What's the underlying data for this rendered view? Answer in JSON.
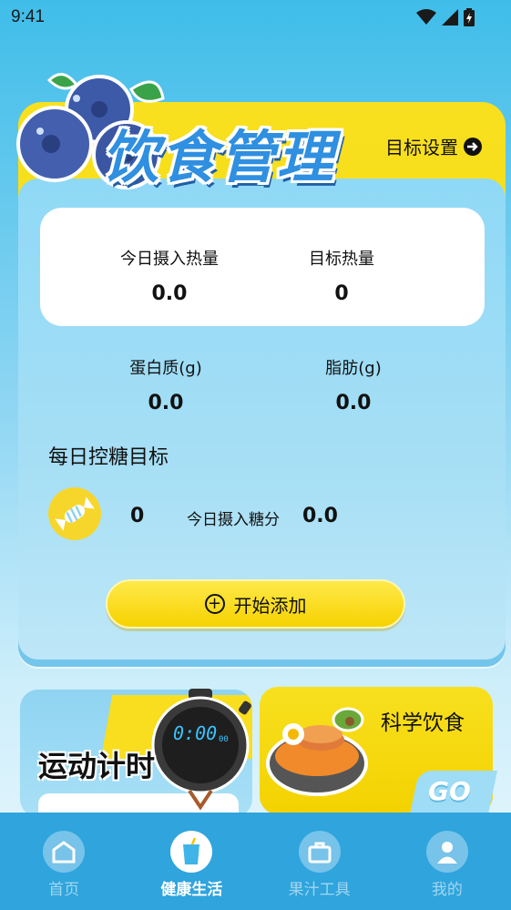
{
  "status_bar": {
    "time": "9:41"
  },
  "header": {
    "title": "饮食管理",
    "target_setting_label": "目标设置"
  },
  "calories": {
    "today_label": "今日摄入热量",
    "today_value": "0.0",
    "target_label": "目标热量",
    "target_value": "0"
  },
  "macros": {
    "protein_label": "蛋白质(g)",
    "protein_value": "0.0",
    "fat_label": "脂肪(g)",
    "fat_value": "0.0"
  },
  "sugar": {
    "title": "每日控糖目标",
    "goal_value": "0",
    "today_label": "今日摄入糖分",
    "today_value": "0.0"
  },
  "start_add_label": "开始添加",
  "cards": {
    "exercise_title": "运动计时",
    "stopwatch_display": "0:00",
    "stopwatch_ms": "00",
    "science_title": "科学饮食",
    "go_label": "GO"
  },
  "bottom_nav": [
    {
      "label": "首页",
      "icon": "home-icon",
      "active": false
    },
    {
      "label": "健康生活",
      "icon": "drink-icon",
      "active": true
    },
    {
      "label": "果汁工具",
      "icon": "toolbox-icon",
      "active": false
    },
    {
      "label": "我的",
      "icon": "user-icon",
      "active": false
    }
  ],
  "colors": {
    "accent_yellow": "#f6d600",
    "accent_blue": "#2fa4dd",
    "title_blue": "#2f8fe0"
  }
}
